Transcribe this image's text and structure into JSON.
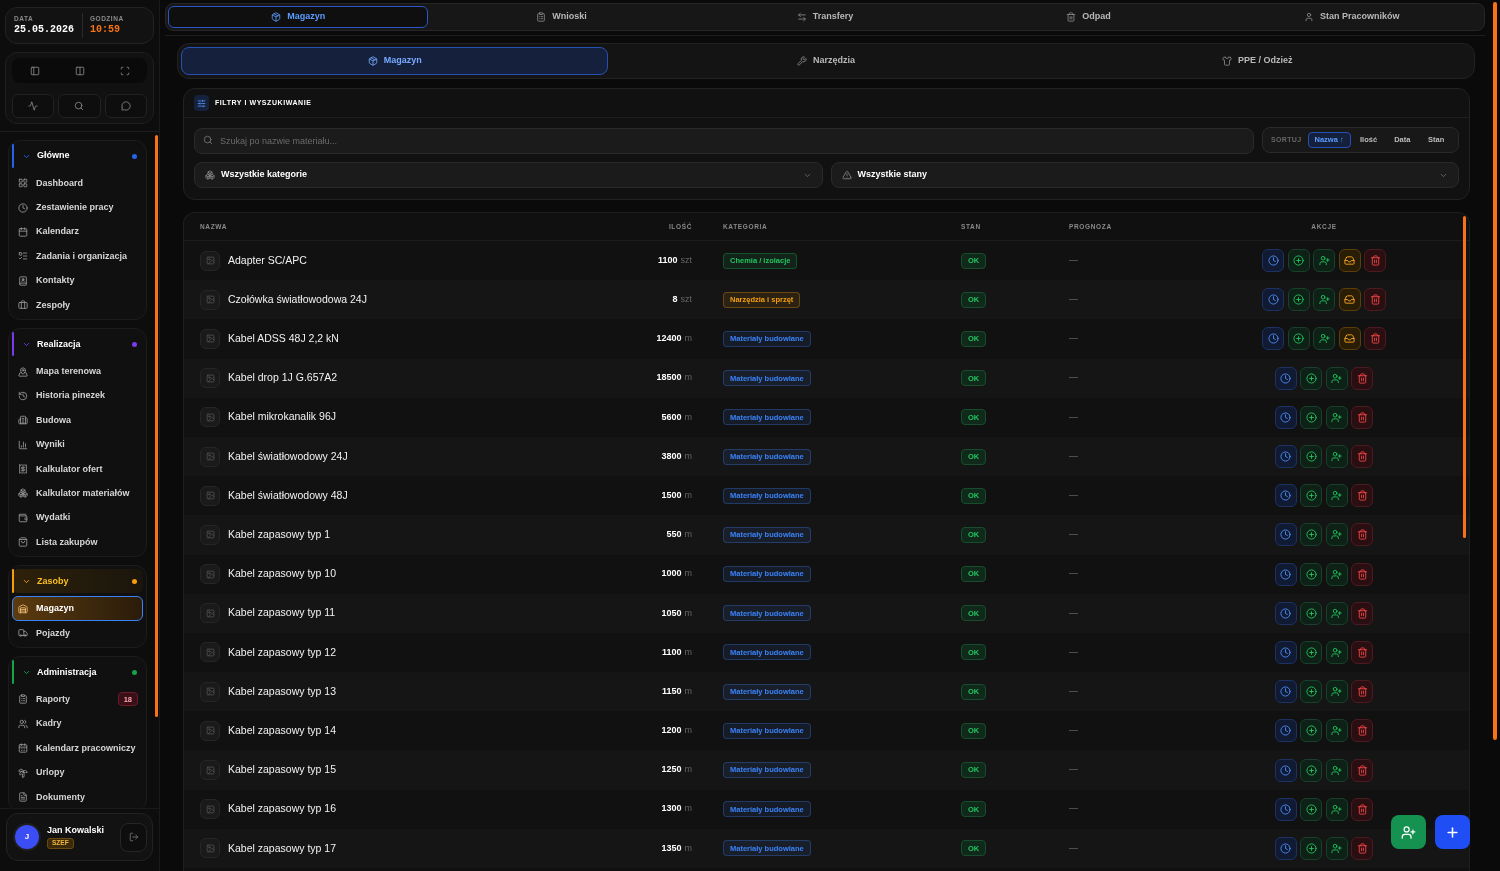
{
  "sidebar": {
    "date": {
      "label": "DATA",
      "value": "25.05.2026"
    },
    "time": {
      "label": "GODZINA",
      "value": "10:59"
    },
    "groups": [
      {
        "title": "Główne",
        "color": "#2563eb",
        "expanded": true,
        "active": false,
        "items": [
          {
            "label": "Dashboard",
            "selected": false
          },
          {
            "label": "Zestawienie pracy",
            "selected": false
          },
          {
            "label": "Kalendarz",
            "selected": false
          },
          {
            "label": "Zadania i organizacja",
            "selected": false
          },
          {
            "label": "Kontakty",
            "selected": false
          },
          {
            "label": "Zespoły",
            "selected": false
          }
        ]
      },
      {
        "title": "Realizacja",
        "color": "#7c3aed",
        "expanded": true,
        "active": false,
        "items": [
          {
            "label": "Mapa terenowa",
            "selected": false
          },
          {
            "label": "Historia pinezek",
            "selected": false
          },
          {
            "label": "Budowa",
            "selected": false
          },
          {
            "label": "Wyniki",
            "selected": false
          },
          {
            "label": "Kalkulator ofert",
            "selected": false
          },
          {
            "label": "Kalkulator materiałów",
            "selected": false
          },
          {
            "label": "Wydatki",
            "selected": false
          },
          {
            "label": "Lista zakupów",
            "selected": false
          }
        ]
      },
      {
        "title": "Zasoby",
        "color": "#f59e0b",
        "expanded": true,
        "active": true,
        "items": [
          {
            "label": "Magazyn",
            "selected": true
          },
          {
            "label": "Pojazdy",
            "selected": false
          }
        ]
      },
      {
        "title": "Administracja",
        "color": "#16a34a",
        "expanded": true,
        "active": false,
        "items": [
          {
            "label": "Raporty",
            "selected": false,
            "badge": "18"
          },
          {
            "label": "Kadry",
            "selected": false
          },
          {
            "label": "Kalendarz pracowniczy",
            "selected": false
          },
          {
            "label": "Urlopy",
            "selected": false
          },
          {
            "label": "Dokumenty",
            "selected": false
          }
        ]
      }
    ],
    "user": {
      "initial": "J",
      "name": "Jan Kowalski",
      "role": "SZEF"
    }
  },
  "main_tabs": [
    {
      "label": "Magazyn",
      "selected": true
    },
    {
      "label": "Wnioski",
      "selected": false
    },
    {
      "label": "Transfery",
      "selected": false
    },
    {
      "label": "Odpad",
      "selected": false
    },
    {
      "label": "Stan Pracowników",
      "selected": false
    }
  ],
  "sub_tabs": [
    {
      "label": "Magazyn",
      "selected": true
    },
    {
      "label": "Narzędzia",
      "selected": false
    },
    {
      "label": "PPE / Odzież",
      "selected": false
    }
  ],
  "filters": {
    "title": "FILTRY I WYSZUKIWANIE",
    "search": {
      "placeholder": "Szukaj po nazwie materiału..."
    },
    "sort": {
      "label": "SORTUJ",
      "options": [
        {
          "label": "Nazwa ↑",
          "selected": true
        },
        {
          "label": "Ilość",
          "selected": false
        },
        {
          "label": "Data",
          "selected": false
        },
        {
          "label": "Stan",
          "selected": false
        }
      ]
    },
    "category_select": {
      "value": "Wszystkie kategorie"
    },
    "state_select": {
      "value": "Wszystkie stany"
    }
  },
  "table": {
    "columns": [
      "NAZWA",
      "ILOŚĆ",
      "KATEGORIA",
      "STAN",
      "PROGNOZA",
      "AKCJE"
    ],
    "rows": [
      {
        "name": "Adapter SC/APC",
        "quantity": "1100",
        "unit": "szt",
        "category": {
          "label": "Chemia / izolacje",
          "color": "#22c55e"
        },
        "status": "OK",
        "forecast": "—",
        "actions": [
          {
            "kind": "history"
          },
          {
            "kind": "add"
          },
          {
            "kind": "assign"
          },
          {
            "kind": "inbox"
          },
          {
            "kind": "delete"
          }
        ]
      },
      {
        "name": "Czołówka światłowodowa 24J",
        "quantity": "8",
        "unit": "szt",
        "category": {
          "label": "Narzędzia i sprzęt",
          "color": "#f59e0b"
        },
        "status": "OK",
        "forecast": "—",
        "actions": [
          {
            "kind": "history"
          },
          {
            "kind": "add"
          },
          {
            "kind": "assign"
          },
          {
            "kind": "inbox"
          },
          {
            "kind": "delete"
          }
        ]
      },
      {
        "name": "Kabel ADSS 48J 2,2 kN",
        "quantity": "12400",
        "unit": "m",
        "category": {
          "label": "Materiały budowlane",
          "color": "#3b82f6"
        },
        "status": "OK",
        "forecast": "—",
        "actions": [
          {
            "kind": "history"
          },
          {
            "kind": "add"
          },
          {
            "kind": "assign"
          },
          {
            "kind": "inbox"
          },
          {
            "kind": "delete"
          }
        ]
      },
      {
        "name": "Kabel drop 1J G.657A2",
        "quantity": "18500",
        "unit": "m",
        "category": {
          "label": "Materiały budowlane",
          "color": "#3b82f6"
        },
        "status": "OK",
        "forecast": "—",
        "actions": [
          {
            "kind": "history"
          },
          {
            "kind": "add"
          },
          {
            "kind": "assign"
          },
          {
            "kind": "delete"
          }
        ]
      },
      {
        "name": "Kabel mikrokanalik 96J",
        "quantity": "5600",
        "unit": "m",
        "category": {
          "label": "Materiały budowlane",
          "color": "#3b82f6"
        },
        "status": "OK",
        "forecast": "—",
        "actions": [
          {
            "kind": "history"
          },
          {
            "kind": "add"
          },
          {
            "kind": "assign"
          },
          {
            "kind": "delete"
          }
        ]
      },
      {
        "name": "Kabel światłowodowy 24J",
        "quantity": "3800",
        "unit": "m",
        "category": {
          "label": "Materiały budowlane",
          "color": "#3b82f6"
        },
        "status": "OK",
        "forecast": "—",
        "actions": [
          {
            "kind": "history"
          },
          {
            "kind": "add"
          },
          {
            "kind": "assign"
          },
          {
            "kind": "delete"
          }
        ]
      },
      {
        "name": "Kabel światłowodowy 48J",
        "quantity": "1500",
        "unit": "m",
        "category": {
          "label": "Materiały budowlane",
          "color": "#3b82f6"
        },
        "status": "OK",
        "forecast": "—",
        "actions": [
          {
            "kind": "history"
          },
          {
            "kind": "add"
          },
          {
            "kind": "assign"
          },
          {
            "kind": "delete"
          }
        ]
      },
      {
        "name": "Kabel zapasowy typ 1",
        "quantity": "550",
        "unit": "m",
        "category": {
          "label": "Materiały budowlane",
          "color": "#3b82f6"
        },
        "status": "OK",
        "forecast": "—",
        "actions": [
          {
            "kind": "history"
          },
          {
            "kind": "add"
          },
          {
            "kind": "assign"
          },
          {
            "kind": "delete"
          }
        ]
      },
      {
        "name": "Kabel zapasowy typ 10",
        "quantity": "1000",
        "unit": "m",
        "category": {
          "label": "Materiały budowlane",
          "color": "#3b82f6"
        },
        "status": "OK",
        "forecast": "—",
        "actions": [
          {
            "kind": "history"
          },
          {
            "kind": "add"
          },
          {
            "kind": "assign"
          },
          {
            "kind": "delete"
          }
        ]
      },
      {
        "name": "Kabel zapasowy typ 11",
        "quantity": "1050",
        "unit": "m",
        "category": {
          "label": "Materiały budowlane",
          "color": "#3b82f6"
        },
        "status": "OK",
        "forecast": "—",
        "actions": [
          {
            "kind": "history"
          },
          {
            "kind": "add"
          },
          {
            "kind": "assign"
          },
          {
            "kind": "delete"
          }
        ]
      },
      {
        "name": "Kabel zapasowy typ 12",
        "quantity": "1100",
        "unit": "m",
        "category": {
          "label": "Materiały budowlane",
          "color": "#3b82f6"
        },
        "status": "OK",
        "forecast": "—",
        "actions": [
          {
            "kind": "history"
          },
          {
            "kind": "add"
          },
          {
            "kind": "assign"
          },
          {
            "kind": "delete"
          }
        ]
      },
      {
        "name": "Kabel zapasowy typ 13",
        "quantity": "1150",
        "unit": "m",
        "category": {
          "label": "Materiały budowlane",
          "color": "#3b82f6"
        },
        "status": "OK",
        "forecast": "—",
        "actions": [
          {
            "kind": "history"
          },
          {
            "kind": "add"
          },
          {
            "kind": "assign"
          },
          {
            "kind": "delete"
          }
        ]
      },
      {
        "name": "Kabel zapasowy typ 14",
        "quantity": "1200",
        "unit": "m",
        "category": {
          "label": "Materiały budowlane",
          "color": "#3b82f6"
        },
        "status": "OK",
        "forecast": "—",
        "actions": [
          {
            "kind": "history"
          },
          {
            "kind": "add"
          },
          {
            "kind": "assign"
          },
          {
            "kind": "delete"
          }
        ]
      },
      {
        "name": "Kabel zapasowy typ 15",
        "quantity": "1250",
        "unit": "m",
        "category": {
          "label": "Materiały budowlane",
          "color": "#3b82f6"
        },
        "status": "OK",
        "forecast": "—",
        "actions": [
          {
            "kind": "history"
          },
          {
            "kind": "add"
          },
          {
            "kind": "assign"
          },
          {
            "kind": "delete"
          }
        ]
      },
      {
        "name": "Kabel zapasowy typ 16",
        "quantity": "1300",
        "unit": "m",
        "category": {
          "label": "Materiały budowlane",
          "color": "#3b82f6"
        },
        "status": "OK",
        "forecast": "—",
        "actions": [
          {
            "kind": "history"
          },
          {
            "kind": "add"
          },
          {
            "kind": "assign"
          },
          {
            "kind": "delete"
          }
        ]
      },
      {
        "name": "Kabel zapasowy typ 17",
        "quantity": "1350",
        "unit": "m",
        "category": {
          "label": "Materiały budowlane",
          "color": "#3b82f6"
        },
        "status": "OK",
        "forecast": "—",
        "actions": [
          {
            "kind": "history"
          },
          {
            "kind": "add"
          },
          {
            "kind": "assign"
          },
          {
            "kind": "delete"
          }
        ]
      }
    ]
  }
}
